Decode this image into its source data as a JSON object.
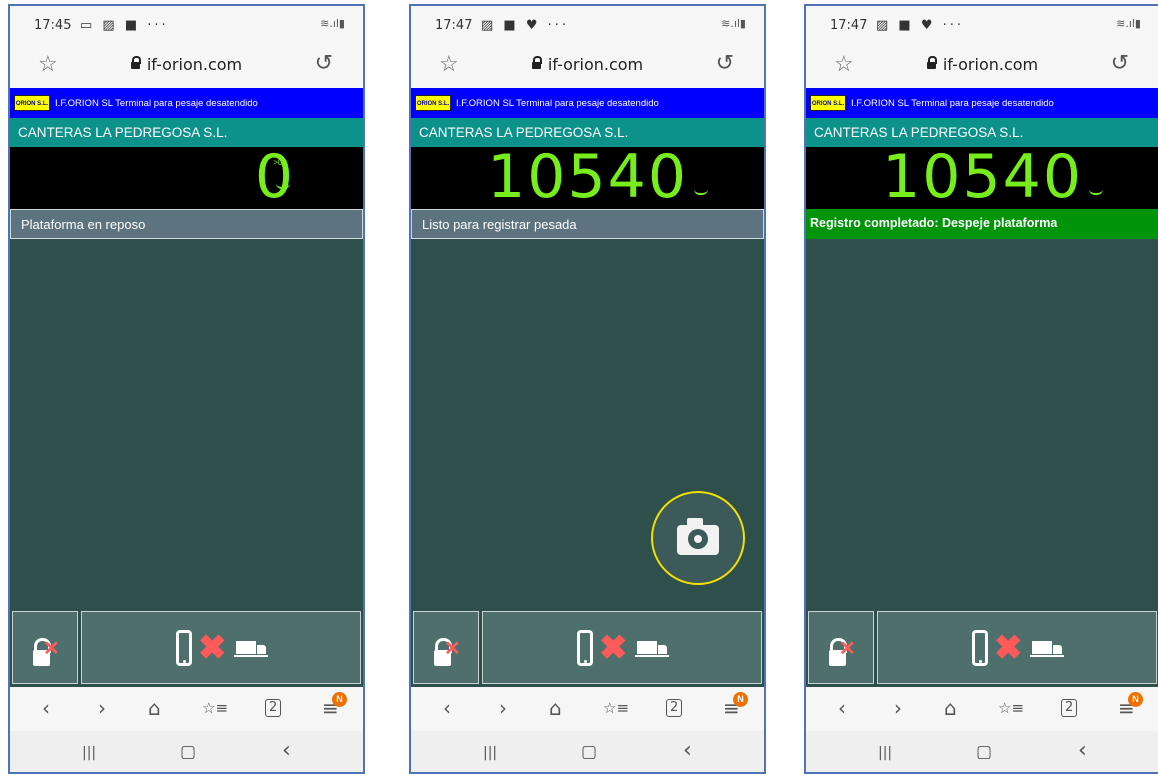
{
  "screens": [
    {
      "status_time": "17:45",
      "status_icons": "▭ ▨ ■ ···",
      "url": "if-orion.com",
      "brand_logo_text": "ORION S.L.",
      "brand_text": "I.F.ORION SL Terminal para pesaje desatendido",
      "company": "CANTERAS LA PEDREGOSA S.L.",
      "weight": "0",
      "zero_indicator": ">0<",
      "message": "Plataforma en reposo",
      "message_state": "idle",
      "camera_button": false,
      "nav_badge": "N"
    },
    {
      "status_time": "17:47",
      "status_icons": "▨ ■ ♥ ···",
      "url": "if-orion.com",
      "brand_logo_text": "ORION S.L.",
      "brand_text": "I.F.ORION SL Terminal para pesaje desatendido",
      "company": "CANTERAS LA PEDREGOSA S.L.",
      "weight": "10540",
      "zero_indicator": "",
      "message": "Listo para registrar pesada",
      "message_state": "idle",
      "camera_button": true,
      "nav_badge": "N"
    },
    {
      "status_time": "17:47",
      "status_icons": "▨ ■ ♥ ···",
      "url": "if-orion.com",
      "brand_logo_text": "ORION S.L.",
      "brand_text": "I.F.ORION SL Terminal para pesaje desatendido",
      "company": "CANTERAS LA PEDREGOSA S.L.",
      "weight": "10540",
      "zero_indicator": "",
      "message": "Registro completado:  Despeje plataforma",
      "message_state": "ok",
      "camera_button": false,
      "nav_badge": "N"
    }
  ],
  "colors": {
    "brand_bar": "#0000ff",
    "company_bar": "#0c918b",
    "weight_digits": "#77ee1c",
    "main_background": "#2f4f4d",
    "message_ok": "#00940a",
    "cancel_x": "#ff5a5a",
    "camera_ring": "#f1e100",
    "frame_border": "#4f74b6"
  },
  "icons": {
    "status_right": "wifi-signal-battery-icons",
    "favorite": "star-icon",
    "lock": "lock-icon",
    "reload": "reload-icon",
    "unlock": "unlocked-padlock-icon",
    "gate": "phone-cancel-truck-icon",
    "camera": "camera-icon",
    "nav": [
      "back-icon",
      "forward-icon",
      "home-icon",
      "bookmarks-icon",
      "tabs-icon",
      "menu-icon"
    ],
    "system": [
      "recent-apps-icon",
      "home-button-icon",
      "system-back-icon"
    ]
  },
  "glyphs": {
    "wifi": "≋.ıl▮",
    "star": "☆",
    "reload": "↺",
    "back": "‹",
    "forward": "›",
    "home": "⌂",
    "bookmarks": "☆≡",
    "tabs": "2",
    "menu": "≡",
    "recents": "|||",
    "home_button": "▢",
    "system_back": "‹"
  }
}
